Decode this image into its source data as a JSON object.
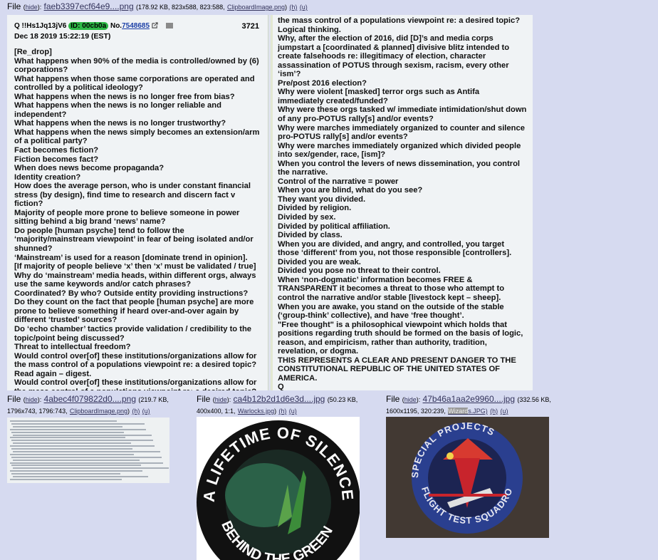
{
  "files": [
    {
      "file_label": "File",
      "hide_open": "(",
      "hide_label": "hide",
      "hide_close": "):",
      "filename": "faeb3397ecf64e9....png",
      "meta": "(178.92 KB, 823x588, 823:588,",
      "orig_name": "ClipboardImage.png",
      "h_link": "(h)",
      "u_link": "(u)"
    },
    {
      "file_label": "File",
      "hide_open": "(",
      "hide_label": "hide",
      "hide_close": "):",
      "filename": "4abec4f079822d0....png",
      "meta": "(219.7 KB,",
      "meta2": "1796x743, 1796:743,",
      "orig_name": "ClipboardImage.png",
      "h_link": "(h)",
      "u_link": "(u)"
    },
    {
      "file_label": "File",
      "hide_open": "(",
      "hide_label": "hide",
      "hide_close": "):",
      "filename": "ca4b12b2d1d6e3d....jpg",
      "meta": "(50.23 KB,",
      "meta2": "400x400, 1:1,",
      "orig_name": "Warlocks.jpg",
      "h_link": "(h)",
      "u_link": "(u)"
    },
    {
      "file_label": "File",
      "hide_open": "(",
      "hide_label": "hide",
      "hide_close": "):",
      "filename": "47b46a1aa2e9960....jpg",
      "meta": "(332.56 KB,",
      "meta2": "1600x1195, 320:239,",
      "orig_name_hl": "Wizard",
      "orig_name_rest": "s.JPG)",
      "h_link": "(h)",
      "u_link": "(u)"
    }
  ],
  "screenshot": {
    "tripcode": "Q !!Hs1Jq13jV6",
    "id_badge": "ID: 00cb0a",
    "no_prefix": "No.",
    "post_number": "7548685",
    "ext_icon": "external-link-icon",
    "reply_count": "3721",
    "date": "Dec 18 2019 15:22:19 (EST)",
    "left_text": [
      "[Re_drop]",
      "What happens when 90% of the media is controlled/owned by (6) corporations?",
      "What happens when those same corporations are operated and controlled by a political ideology?",
      "What happens when the news is no longer free from bias?",
      "What happens when the news is no longer reliable and independent?",
      "What happens when the news is no longer trustworthy?",
      "What happens when the news simply becomes an extension/arm of a political party?",
      "Fact becomes fiction?",
      "Fiction becomes fact?",
      "When does news become propaganda?",
      "Identity creation?",
      "How does the average person, who is under constant financial stress (by design), find time to research and discern fact v fiction?",
      "Majority of people more prone to believe someone in power sitting behind a big brand ‘news’ name?",
      "Do people [human psyche] tend to follow the ‘majority/mainstream viewpoint’ in fear of being isolated and/or shunned?",
      "‘Mainstream’ is used for a reason [dominate trend in opinion].",
      "[If majority of people believe ‘x’ then ‘x’ must be validated / true]",
      "Why do ‘mainstream’ media heads, within different orgs, always use the same keywords and/or catch phrases?",
      "Coordinated? By who? Outside entity providing instructions?",
      "Do they count on the fact that people [human psyche] are more prone to believe something if heard over-and-over again by different ‘trusted’ sources?",
      "Do ‘echo chamber’ tactics provide validation / credibility to the topic/point being discussed?",
      "Threat to intellectual freedom?",
      "Would control over[of] these institutions/organizations allow for the mass control of a populations viewpoint re: a desired topic?",
      "Read again – digest.",
      "Would control over[of] these institutions/organizations allow for the mass control of a populations viewpoint re: a desired topic?",
      "Logical thinking."
    ],
    "right_text": [
      "the mass control of a populations viewpoint re: a desired topic?",
      "Logical thinking.",
      "Why, after the election of 2016, did [D]’s and media corps jumpstart a [coordinated & planned] divisive blitz intended to create falsehoods re: illegitimacy of election, character assassination of POTUS through sexism, racism, every other ‘ism’?",
      "Pre/post 2016 election?",
      "Why were violent [masked] terror orgs such as Antifa immediately created/funded?",
      "Why were these orgs tasked w/ immediate intimidation/shut down of any pro-POTUS rally[s] and/or events?",
      "Why were marches immediately organized to counter and silence pro-POTUS rally[s] and/or events?",
      "Why were marches immediately organized which divided people into sex/gender, race, [ism]?",
      "When you control the levers of news dissemination, you control the narrative.",
      "Control of the narrative = power",
      "When you are blind, what do you see?",
      "They want you divided.",
      "Divided by religion.",
      "Divided by sex.",
      "Divided by political affiliation.",
      "Divided by class.",
      "When you are divided, and angry, and controlled, you target those ‘different’ from you, not those responsible [controllers].",
      "Divided you are weak.",
      "Divided you pose no threat to their control.",
      "When ‘non-dogmatic’ information becomes FREE & TRANSPARENT it becomes a threat to those who attempt to control the narrative and/or stable [livestock kept – sheep].",
      "When you are awake, you stand on the outside of the stable (‘group-think’ collective), and have ‘free thought’.",
      "\"Free thought\" is a philosophical viewpoint which holds that positions regarding truth should be formed on the basis of logic, reason, and empiricism, rather than authority, tradition, revelation, or dogma.",
      "THIS REPRESENTS A CLEAR AND PRESENT DANGER TO THE CONSTITUTIONAL REPUBLIC OF THE UNITED STATES OF AMERICA.",
      "Q"
    ]
  },
  "patch1": {
    "top_text": "A LIFETIME OF SILENCE",
    "bottom_text": "BEHIND THE GREEN DOOR",
    "colors": {
      "ring": "#111111",
      "globe": "#2f6b4f",
      "text": "#ffffff"
    }
  },
  "patch2": {
    "top_text": "SPECIAL PROJECTS",
    "bottom_text": "FLIGHT TEST SQUADRON",
    "colors": {
      "ring": "#2a3f8f",
      "inner": "#1c2452",
      "text": "#e8e8f0",
      "red": "#c8242c"
    }
  }
}
